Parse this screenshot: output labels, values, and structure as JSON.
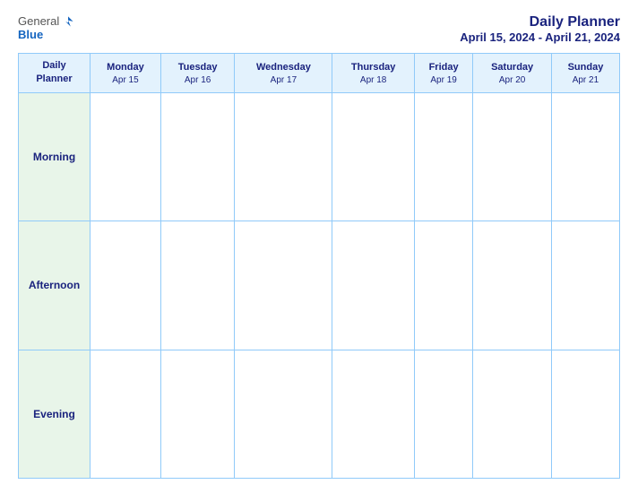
{
  "logo": {
    "general": "General",
    "blue": "Blue"
  },
  "title": {
    "main": "Daily Planner",
    "sub": "April 15, 2024 - April 21, 2024"
  },
  "table": {
    "row_label_header": "Daily\nPlanner",
    "days": [
      {
        "name": "Monday",
        "date": "Apr 15"
      },
      {
        "name": "Tuesday",
        "date": "Apr 16"
      },
      {
        "name": "Wednesday",
        "date": "Apr 17"
      },
      {
        "name": "Thursday",
        "date": "Apr 18"
      },
      {
        "name": "Friday",
        "date": "Apr 19"
      },
      {
        "name": "Saturday",
        "date": "Apr 20"
      },
      {
        "name": "Sunday",
        "date": "Apr 21"
      }
    ],
    "rows": [
      {
        "label": "Morning"
      },
      {
        "label": "Afternoon"
      },
      {
        "label": "Evening"
      }
    ]
  }
}
